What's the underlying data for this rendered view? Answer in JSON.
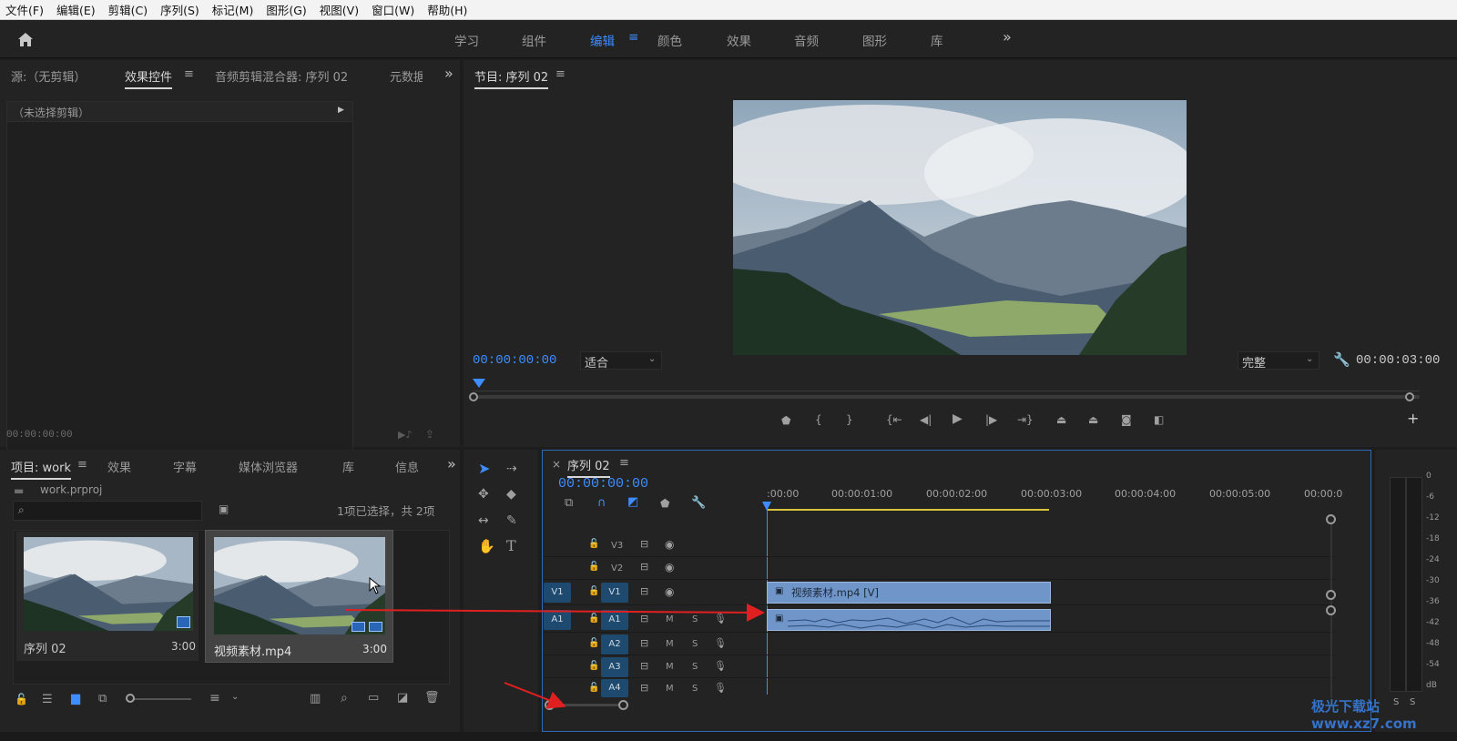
{
  "menu": [
    "文件(F)",
    "编辑(E)",
    "剪辑(C)",
    "序列(S)",
    "标记(M)",
    "图形(G)",
    "视图(V)",
    "窗口(W)",
    "帮助(H)"
  ],
  "workspaces": [
    "学习",
    "组件",
    "编辑",
    "颜色",
    "效果",
    "音频",
    "图形",
    "库"
  ],
  "source_panel": {
    "tabs": [
      "源:（无剪辑）",
      "效果控件",
      "音频剪辑混合器: 序列 02",
      "元数据"
    ],
    "no_clip": "（未选择剪辑）",
    "timecode": "00:00:00:00"
  },
  "program_monitor": {
    "title": "节目: 序列 02",
    "timecode_left": "00:00:00:00",
    "fit": "适合",
    "quality": "完整",
    "timecode_right": "00:00:03:00"
  },
  "project_panel": {
    "tabs": [
      "项目: work",
      "效果",
      "字幕",
      "媒体浏览器",
      "库",
      "信息"
    ],
    "file": "work.prproj",
    "selection_info": "1项已选择，共 2项",
    "items": [
      {
        "name": "序列 02",
        "duration": "3:00"
      },
      {
        "name": "视频素材.mp4",
        "duration": "3:00"
      }
    ]
  },
  "timeline": {
    "title": "序列 02",
    "timecode": "00:00:00:00",
    "ruler": [
      ":00:00",
      "00:00:01:00",
      "00:00:02:00",
      "00:00:03:00",
      "00:00:04:00",
      "00:00:05:00",
      "00:00:0"
    ],
    "tracks": [
      {
        "id": "V3",
        "type": "video"
      },
      {
        "id": "V2",
        "type": "video"
      },
      {
        "id": "V1",
        "type": "video",
        "source": "V1"
      },
      {
        "id": "A1",
        "type": "audio",
        "source": "A1"
      },
      {
        "id": "A2",
        "type": "audio"
      },
      {
        "id": "A3",
        "type": "audio"
      },
      {
        "id": "A4",
        "type": "audio"
      }
    ],
    "video_clip": "视频素材.mp4 [V]"
  },
  "meter_scale": [
    "0",
    "-6",
    "-12",
    "-18",
    "-24",
    "-30",
    "-36",
    "-42",
    "-48",
    "-54",
    "dB"
  ],
  "meter_buttons": [
    "S",
    "S"
  ],
  "watermark": "极光下载站 www.xz7.com",
  "colors": {
    "accent": "#3d8dff",
    "clip": "#6f95c9",
    "arrow": "#e02020"
  }
}
